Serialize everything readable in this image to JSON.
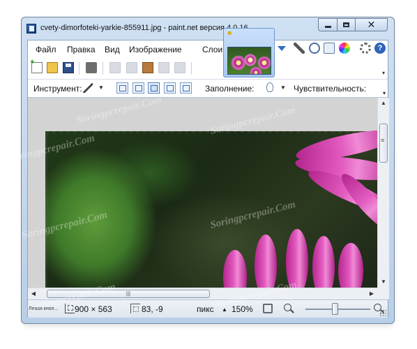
{
  "window": {
    "title": "cvety-dimorfoteki-yarkie-855911.jpg - paint.net версия 4.0.16"
  },
  "menu": {
    "items": [
      "Файл",
      "Правка",
      "Вид",
      "Изображение",
      "Слои"
    ]
  },
  "toolbar": {
    "tool_label": "Инструмент:",
    "fill_label": "Заполнение:",
    "sensitivity_label": "Чувствительность:"
  },
  "watermark": "Soringpcrepair.Com",
  "statusbar": {
    "hint": "Левая кноп...",
    "image_size": "900 × 563",
    "cursor_pos": "83, -9",
    "units": "пикс",
    "zoom": "150%"
  },
  "zoom_slider": {
    "fraction": 0.46
  }
}
